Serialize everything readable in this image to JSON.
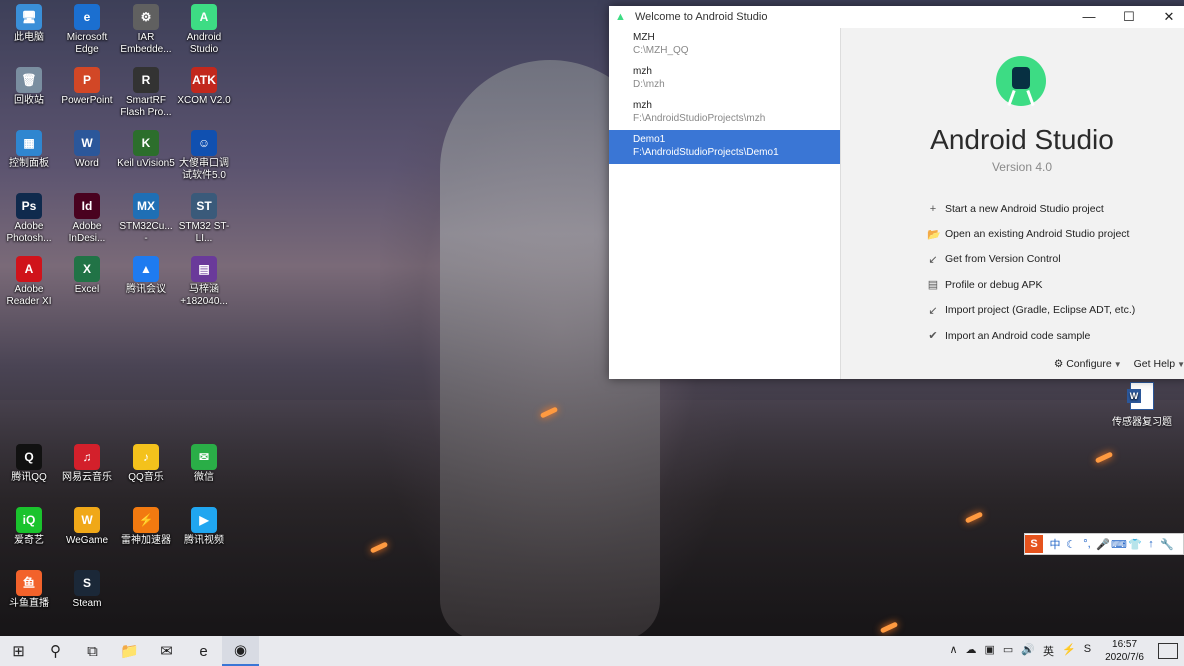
{
  "desktop": {
    "icons": [
      {
        "label": "此电脑",
        "glyph": "🖥",
        "color": "#3a8fd8"
      },
      {
        "label": "Microsoft Edge",
        "glyph": "e",
        "color": "#1b6fd0"
      },
      {
        "label": "IAR Embedde...",
        "glyph": "⚙",
        "color": "#606060"
      },
      {
        "label": "Android Studio",
        "glyph": "A",
        "color": "#3ddc84"
      },
      {
        "label": "回收站",
        "glyph": "🗑",
        "color": "#7a8ea0"
      },
      {
        "label": "PowerPoint",
        "glyph": "P",
        "color": "#d24726"
      },
      {
        "label": "SmartRF Flash Pro...",
        "glyph": "R",
        "color": "#333"
      },
      {
        "label": "XCOM V2.0",
        "glyph": "ATK",
        "color": "#c2281d"
      },
      {
        "label": "控制面板",
        "glyph": "▦",
        "color": "#2f86d0"
      },
      {
        "label": "Word",
        "glyph": "W",
        "color": "#2b579a"
      },
      {
        "label": "Keil uVision5",
        "glyph": "K",
        "color": "#2c6e2c"
      },
      {
        "label": "大傻串口调试软件5.0",
        "glyph": "☺",
        "color": "#1050b0"
      },
      {
        "label": "Adobe Photosh...",
        "glyph": "Ps",
        "color": "#0f2a4d"
      },
      {
        "label": "Adobe InDesi...",
        "glyph": "Id",
        "color": "#49021f"
      },
      {
        "label": "STM32Cu... -",
        "glyph": "MX",
        "color": "#1f6fb5"
      },
      {
        "label": "STM32 ST-LI...",
        "glyph": "ST",
        "color": "#3a5a7a"
      },
      {
        "label": "Adobe Reader XI",
        "glyph": "A",
        "color": "#d0131b"
      },
      {
        "label": "Excel",
        "glyph": "X",
        "color": "#217346"
      },
      {
        "label": "腾讯会议",
        "glyph": "▲",
        "color": "#1e7bf0"
      },
      {
        "label": "马梓涵+182040...",
        "glyph": "▤",
        "color": "#6a3a9a"
      },
      {
        "label": "腾讯QQ",
        "glyph": "Q",
        "color": "#111"
      },
      {
        "label": "网易云音乐",
        "glyph": "♫",
        "color": "#d3202b"
      },
      {
        "label": "QQ音乐",
        "glyph": "♪",
        "color": "#f4c21c"
      },
      {
        "label": "微信",
        "glyph": "✉",
        "color": "#2aae47"
      },
      {
        "label": "爱奇艺",
        "glyph": "iQ",
        "color": "#1ac32d"
      },
      {
        "label": "WeGame",
        "glyph": "W",
        "color": "#f0a818"
      },
      {
        "label": "雷神加速器",
        "glyph": "⚡",
        "color": "#f27a10"
      },
      {
        "label": "腾讯视频",
        "glyph": "▶",
        "color": "#20a6f0"
      },
      {
        "label": "斗鱼直播",
        "glyph": "鱼",
        "color": "#f2622b"
      },
      {
        "label": "Steam",
        "glyph": "S",
        "color": "#1b2838"
      }
    ],
    "doc_icon": {
      "label": "传感器复习题",
      "glyph": "W"
    }
  },
  "window": {
    "title": "Welcome to Android Studio",
    "controls": {
      "minimize": "—",
      "maximize": "☐",
      "close": "✕"
    },
    "recent_projects": [
      {
        "name": "MZH",
        "path": "C:\\MZH_QQ",
        "selected": false
      },
      {
        "name": "mzh",
        "path": "D:\\mzh",
        "selected": false
      },
      {
        "name": "mzh",
        "path": "F:\\AndroidStudioProjects\\mzh",
        "selected": false
      },
      {
        "name": "Demo1",
        "path": "F:\\AndroidStudioProjects\\Demo1",
        "selected": true
      }
    ],
    "product_name": "Android Studio",
    "version": "Version 4.0",
    "actions": [
      {
        "icon": "+",
        "label": "Start a new Android Studio project"
      },
      {
        "icon": "📂",
        "label": "Open an existing Android Studio project"
      },
      {
        "icon": "↙",
        "label": "Get from Version Control"
      },
      {
        "icon": "▤",
        "label": "Profile or debug APK"
      },
      {
        "icon": "↙",
        "label": "Import project (Gradle, Eclipse ADT, etc.)"
      },
      {
        "icon": "✔",
        "label": "Import an Android code sample"
      }
    ],
    "configure": "Configure",
    "get_help": "Get Help"
  },
  "ime": {
    "logo": "S",
    "mode": "中",
    "glyphs": [
      "☾",
      "°,",
      "🎤",
      "⌨",
      "👕",
      "↑",
      "🔧"
    ]
  },
  "taskbar": {
    "buttons": [
      {
        "glyph": "⊞",
        "name": "start-button"
      },
      {
        "glyph": "⚲",
        "name": "search-button"
      },
      {
        "glyph": "⧉",
        "name": "task-view-button"
      },
      {
        "glyph": "📁",
        "name": "file-explorer-button"
      },
      {
        "glyph": "✉",
        "name": "mail-button"
      },
      {
        "glyph": "e",
        "name": "edge-button"
      },
      {
        "glyph": "◉",
        "name": "android-studio-button"
      }
    ],
    "tray_glyphs": [
      "∧",
      "☁",
      "▣",
      "▭",
      "🔊",
      "英",
      "⚡",
      "S"
    ],
    "time": "16:57",
    "date": "2020/7/6"
  }
}
